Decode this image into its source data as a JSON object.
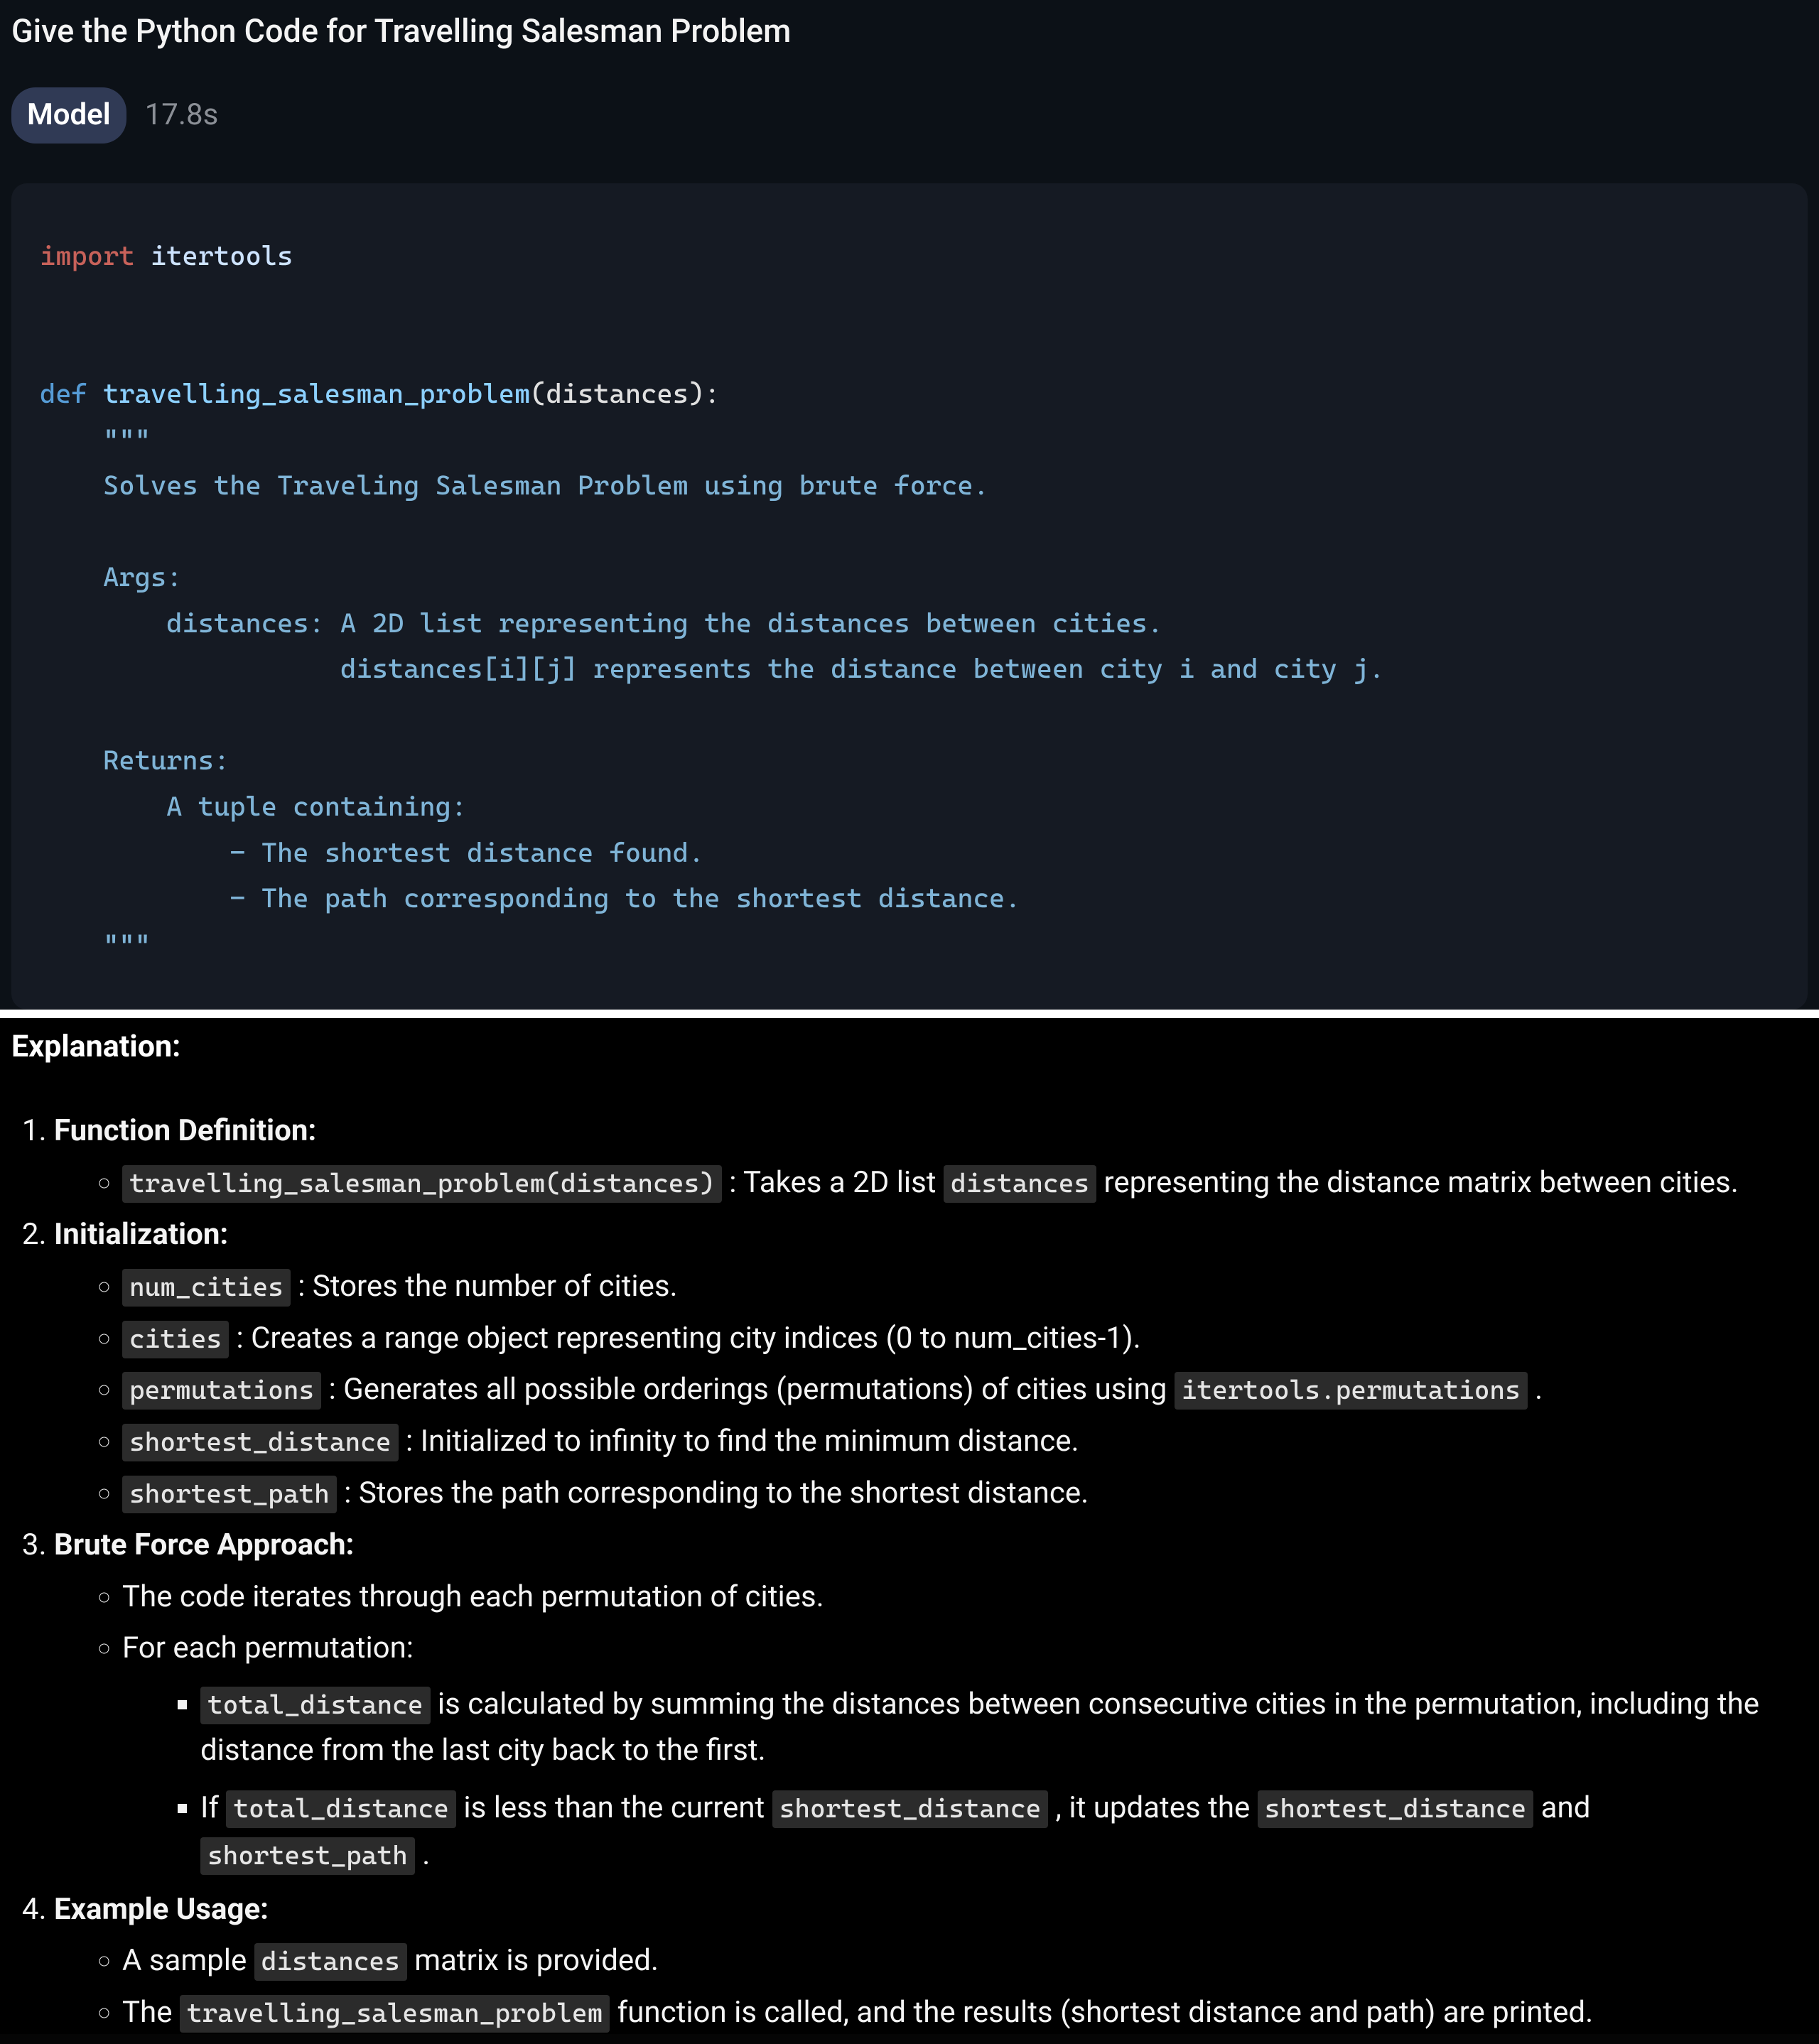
{
  "prompt": "Give the Python Code for Travelling Salesman Problem",
  "model_badge": "Model",
  "model_time": "17.8s",
  "code": {
    "kw_import": "import",
    "imp_mod": " itertools",
    "kw_def": "def",
    "fn_name": " travelling_salesman_problem",
    "fn_params": "(distances):",
    "triple_open": "    \"\"\"",
    "doc1": "    Solves the Traveling Salesman Problem using brute force.",
    "doc_args_hdr": "    Args:",
    "doc_args_l1": "        distances: A 2D list representing the distances between cities.",
    "doc_args_l2": "                   distances[i][j] represents the distance between city i and city j.",
    "doc_ret_hdr": "    Returns:",
    "doc_ret_l1": "        A tuple containing:",
    "doc_ret_l2": "            - The shortest distance found.",
    "doc_ret_l3": "            - The path corresponding to the shortest distance.",
    "triple_close": "    \"\"\""
  },
  "explanation_header": "Explanation:",
  "items": {
    "h1": "Function Definition:",
    "h2": "Initialization:",
    "h3": "Brute Force Approach:",
    "h4": "Example Usage:",
    "c_func_sig": "travelling_salesman_problem(distances)",
    "t_func_sig_pre": " : Takes a 2D list ",
    "c_distances": "distances",
    "t_func_sig_post": " representing the distance matrix between cities.",
    "c_num_cities": "num_cities",
    "t_num_cities": " : Stores the number of cities.",
    "c_cities": "cities",
    "t_cities": " : Creates a range object representing city indices (0 to num_cities-1).",
    "c_permutations": "permutations",
    "t_permutations_pre": " : Generates all possible orderings (permutations) of cities using ",
    "c_itertools_perm": "itertools.permutations",
    "t_permutations_post": " .",
    "c_shortest_distance": "shortest_distance",
    "t_shortest_distance": " : Initialized to infinity to find the minimum distance.",
    "c_shortest_path": "shortest_path",
    "t_shortest_path": " : Stores the path corresponding to the shortest distance.",
    "t_bf_line1": "The code iterates through each permutation of cities.",
    "t_bf_line2": "For each permutation:",
    "c_total_distance": "total_distance",
    "t_total_distance": " is calculated by summing the distances between consecutive cities in the permutation, including the distance from the last city back to the first.",
    "t_if_pre": "If ",
    "t_if_mid1": " is less than the current ",
    "t_if_mid2": " , it updates the ",
    "t_if_mid3": " and ",
    "t_if_post": " .",
    "t_example_l1_pre": "A sample ",
    "t_example_l1_post": " matrix is provided.",
    "t_example_l2_pre": "The ",
    "c_tsp_fn": "travelling_salesman_problem",
    "t_example_l2_post": " function is called, and the results (shortest distance and path) are printed."
  }
}
